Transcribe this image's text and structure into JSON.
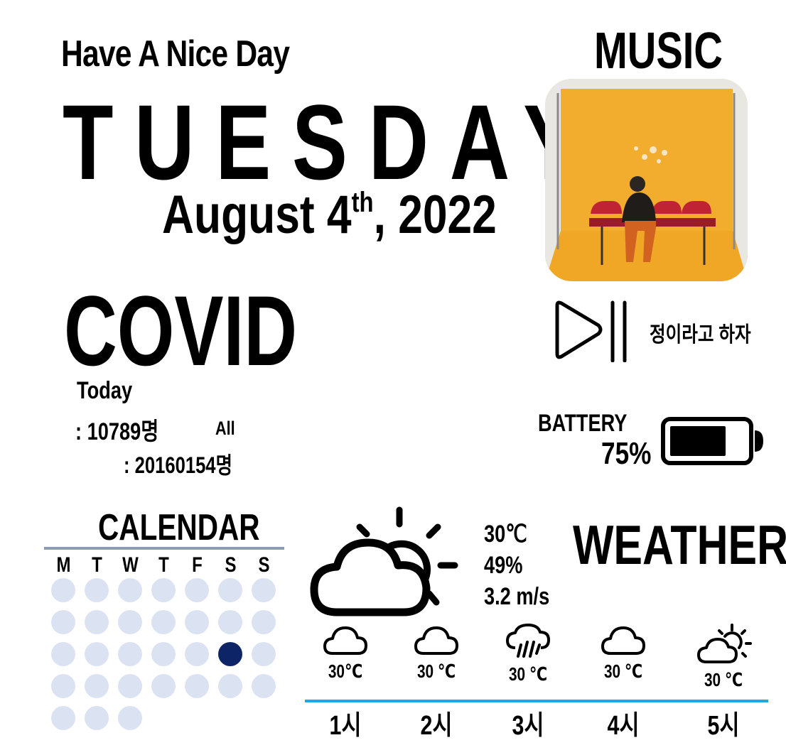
{
  "greeting": "Have A Nice Day",
  "date": {
    "weekday": "TUESDAY",
    "month_day": "August 4",
    "ordinal_suffix": "th",
    "year_part": ", 2022"
  },
  "covid": {
    "title": "COVID",
    "today_label": "Today",
    "today_value": ": 10789명",
    "all_label": "All",
    "all_value": ": 20160154명"
  },
  "music": {
    "title": "MUSIC",
    "song_title": "정이라고 하자",
    "album_colors": {
      "backdrop": "#f2ad2f",
      "wall": "#ececea",
      "chairs": "#b8202e"
    }
  },
  "battery": {
    "label": "BATTERY",
    "value_text": "75%",
    "level_percent": 75
  },
  "calendar": {
    "title": "CALENDAR",
    "weekdays": [
      "M",
      "T",
      "W",
      "T",
      "F",
      "S",
      "S"
    ],
    "day_count": 31,
    "highlighted_day": 20,
    "dot_color": "#dbe2f2",
    "highlight_color": "#0d2466"
  },
  "weather": {
    "title": "WEATHER",
    "current_icon": "partly-cloudy-icon",
    "temperature": "30℃",
    "humidity": "49%",
    "wind": "3.2 m/s",
    "forecast": [
      {
        "icon": "cloud-icon",
        "temp": "30℃",
        "hour": "1시"
      },
      {
        "icon": "cloud-icon",
        "temp": "30 ℃",
        "hour": "2시"
      },
      {
        "icon": "rain-cloud-icon",
        "temp": "30 ℃",
        "hour": "3시"
      },
      {
        "icon": "cloud-icon",
        "temp": "30 ℃",
        "hour": "4시"
      },
      {
        "icon": "partly-cloudy-icon",
        "temp": "30 ℃",
        "hour": "5시"
      }
    ],
    "divider_color": "#1fa9e2"
  }
}
